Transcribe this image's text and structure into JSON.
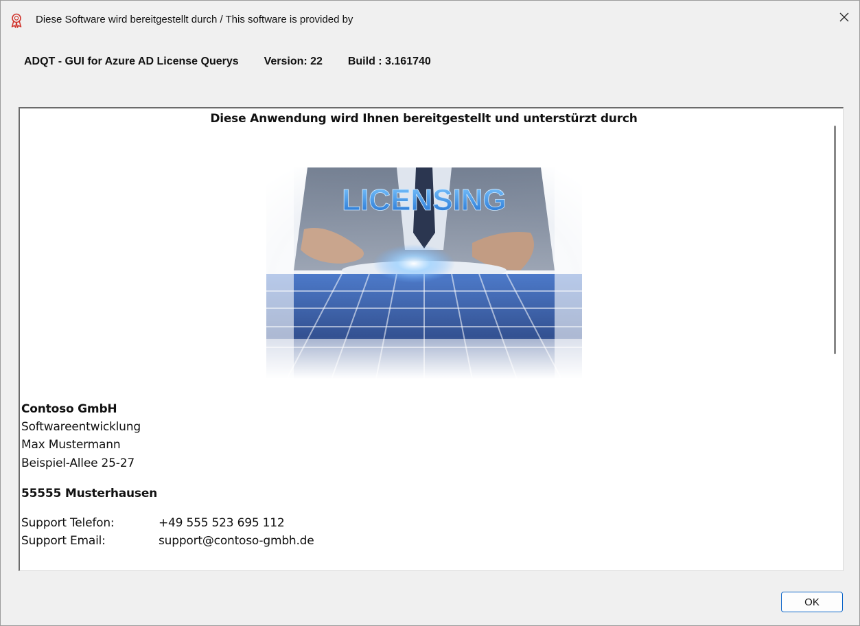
{
  "window": {
    "title": "Diese Software wird bereitgestellt durch / This software is provided by",
    "app_icon": "ribbon-award-icon",
    "close_icon": "close-icon"
  },
  "header": {
    "app_name": "ADQT - GUI for Azure AD License Querys",
    "version": "Version: 22",
    "build": "Build : 3.161740"
  },
  "content": {
    "heading": "Diese Anwendung wird Ihnen bereitgestellt und unterstürzt durch",
    "hero_image_text": "LICENSING",
    "address": {
      "company": "Contoso GmbH",
      "department": "Softwareentwicklung",
      "contact": "Max Mustermann",
      "street": "Beispiel-Allee 25-27",
      "city": "55555 Musterhausen"
    },
    "support": {
      "phone_label": "Support Telefon:",
      "phone_value": "+49 555 523 695 112",
      "email_label": "Support Email:",
      "email_value": "support@contoso-gmbh.de"
    }
  },
  "footer": {
    "ok_label": "OK"
  },
  "colors": {
    "accent": "#0a64c8",
    "icon_red": "#d0342c"
  }
}
